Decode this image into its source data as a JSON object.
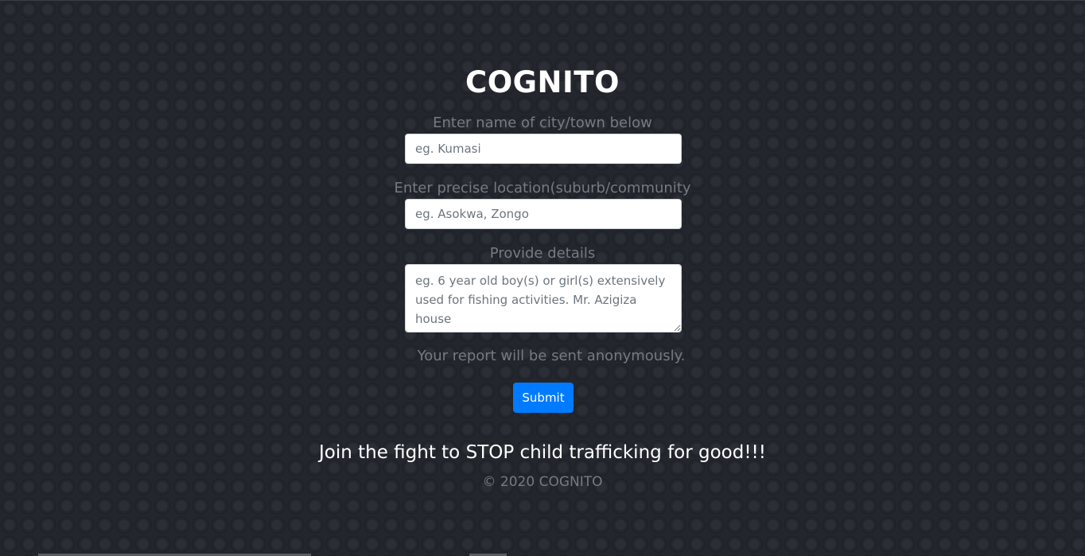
{
  "app": {
    "title": "COGNITO"
  },
  "form": {
    "city_label": "Enter name of city/town below",
    "city_placeholder": "eg. Kumasi",
    "location_label": "Enter precise location(suburb/community",
    "location_placeholder": "eg. Asokwa, Zongo",
    "details_label": "Provide details",
    "details_placeholder": "eg. 6 year old boy(s) or girl(s) extensively used for fishing activities. Mr. Azigiza house",
    "anonymous_note": "Your report will be sent anonymously.",
    "submit_label": "Submit"
  },
  "footer": {
    "slogan": "Join the fight to STOP child trafficking for good!!!",
    "copyright": "© 2020 COGNITO"
  },
  "colors": {
    "background": "#23262d",
    "accent": "#007bff",
    "muted_text": "#767a82"
  }
}
